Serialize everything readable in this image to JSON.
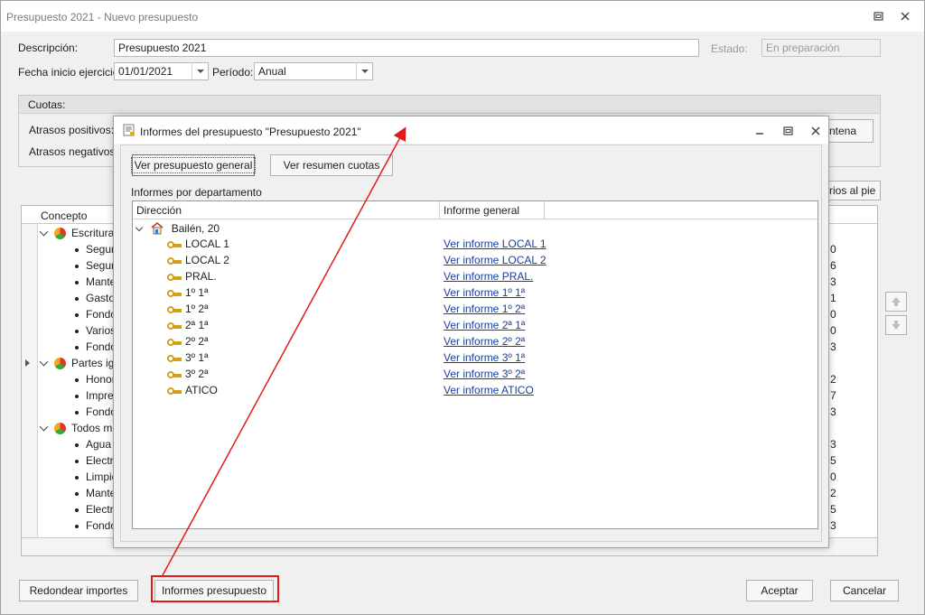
{
  "window": {
    "title": "Presupuesto 2021 - Nuevo presupuesto"
  },
  "form": {
    "descripcion_label": "Descripción:",
    "descripcion_value": "Presupuesto 2021",
    "estado_label": "Estado:",
    "estado_value": "En preparación",
    "fecha_label": "Fecha inicio ejercicio:",
    "fecha_value": "01/01/2021",
    "periodo_label": "Período:",
    "periodo_value": "Anual"
  },
  "cuotas": {
    "title": "Cuotas:",
    "atrasos_positivos_label": "Atrasos positivos:",
    "atrasos_negativos_label": "Atrasos negativos:",
    "centena_button": "ntena",
    "pie_button": "rios al pie"
  },
  "grid": {
    "column_concepto": "Concepto",
    "groups": [
      {
        "label": "Escritura",
        "items": [
          "Segur",
          "Segur",
          "Mante",
          "Gasto",
          "Fondo",
          "Varios",
          "Fondo"
        ]
      },
      {
        "label": "Partes igu",
        "items": [
          "Honor",
          "Impre",
          "Fondo"
        ]
      },
      {
        "label": "Todos me",
        "items": [
          "Agua",
          "Electr",
          "Limpie",
          "Mante",
          "Electr",
          "Fondo"
        ]
      }
    ],
    "right_digits": [
      "0",
      "6",
      "3",
      "1",
      "0",
      "0",
      "3",
      "2",
      "7",
      "3",
      "3",
      "5",
      "0",
      "2",
      "5",
      "3"
    ]
  },
  "bottom": {
    "redondear": "Redondear importes",
    "informes": "Informes presupuesto",
    "aceptar": "Aceptar",
    "cancelar": "Cancelar"
  },
  "modal": {
    "title": "Informes del presupuesto \"Presupuesto 2021\"",
    "btn_general": "Ver presupuesto general",
    "btn_cuotas": "Ver resumen cuotas",
    "section_label": "Informes por departamento",
    "col_direccion": "Dirección",
    "col_informe": "Informe general",
    "building": "Bailén, 20",
    "departments": [
      {
        "name": "LOCAL 1",
        "link": "Ver informe LOCAL 1"
      },
      {
        "name": "LOCAL 2",
        "link": "Ver informe LOCAL 2"
      },
      {
        "name": "PRAL.",
        "link": "Ver informe PRAL."
      },
      {
        "name": "1º 1ª",
        "link": "Ver informe 1º 1ª"
      },
      {
        "name": "1º 2ª",
        "link": "Ver informe 1º 2ª"
      },
      {
        "name": "2ª 1ª",
        "link": "Ver informe 2ª 1ª"
      },
      {
        "name": "2º 2ª",
        "link": "Ver informe 2º 2ª"
      },
      {
        "name": "3º 1ª",
        "link": "Ver informe 3º 1ª"
      },
      {
        "name": "3º 2ª",
        "link": "Ver informe 3º 2ª"
      },
      {
        "name": "ATICO",
        "link": "Ver informe ATICO"
      }
    ]
  },
  "colors": {
    "highlight": "#e21a1a",
    "link": "#1a3fa0"
  },
  "icons": [
    "close-icon",
    "restore-icon",
    "minimize-icon",
    "key-icon",
    "house-icon",
    "pie-icon",
    "arrow-up-icon",
    "arrow-down-icon"
  ]
}
